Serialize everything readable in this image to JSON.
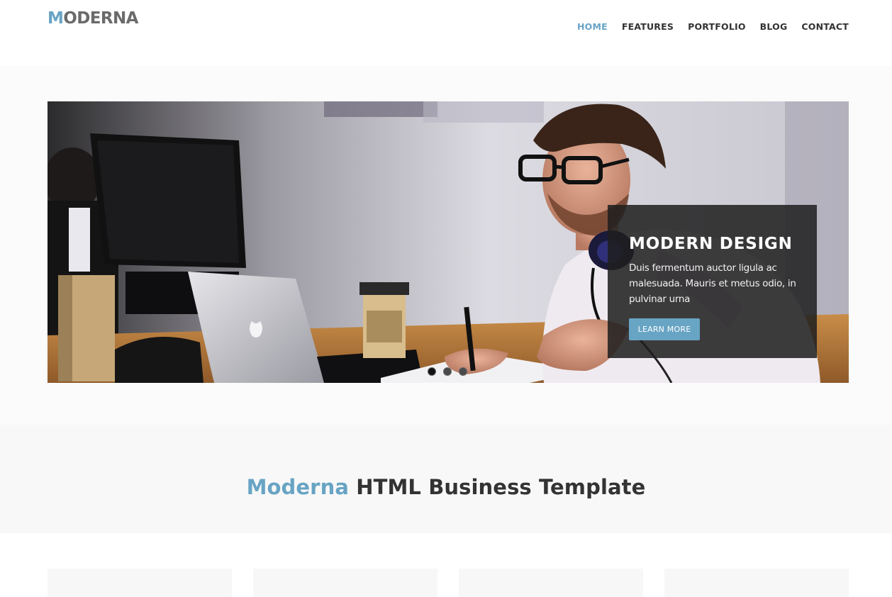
{
  "brand": {
    "first_letter": "M",
    "rest": "ODERNA"
  },
  "nav": {
    "items": [
      {
        "label": "HOME",
        "active": true
      },
      {
        "label": "FEATURES",
        "active": false
      },
      {
        "label": "PORTFOLIO",
        "active": false
      },
      {
        "label": "BLOG",
        "active": false
      },
      {
        "label": "CONTACT",
        "active": false
      }
    ]
  },
  "slider": {
    "caption_title": "MODERN DESIGN",
    "caption_text": "Duis fermentum auctor ligula ac malesuada. Mauris et metus odio, in pulvinar urna",
    "button_label": "LEARN MORE",
    "slide_count": 3,
    "active_slide": 1
  },
  "callout": {
    "accent": "Moderna",
    "rest": "HTML Business Template"
  },
  "features": {
    "card_count": 4
  },
  "colors": {
    "accent": "#68a4c4",
    "text": "#333333",
    "caption_bg": "#1e1e1e"
  }
}
